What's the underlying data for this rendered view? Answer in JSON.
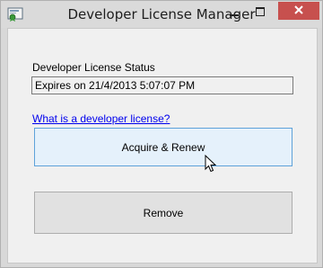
{
  "window": {
    "title": "Developer License Manager",
    "minimize_glyph": "—",
    "maximize_glyph": "☐",
    "close_glyph": "✕"
  },
  "form": {
    "status_label": "Developer License Status",
    "status_value": "Expires on 21/4/2013 5:07:07 PM",
    "help_link": "What is a developer license?",
    "acquire_button": "Acquire & Renew",
    "remove_button": "Remove"
  },
  "icons": {
    "app": "certificate-icon",
    "cursor": "mouse-pointer-icon"
  },
  "colors": {
    "close_button": "#c7504e",
    "link": "#0000ee",
    "acquire_hover_bg": "#e5f1fb",
    "acquire_hover_border": "#5ea2d9"
  }
}
